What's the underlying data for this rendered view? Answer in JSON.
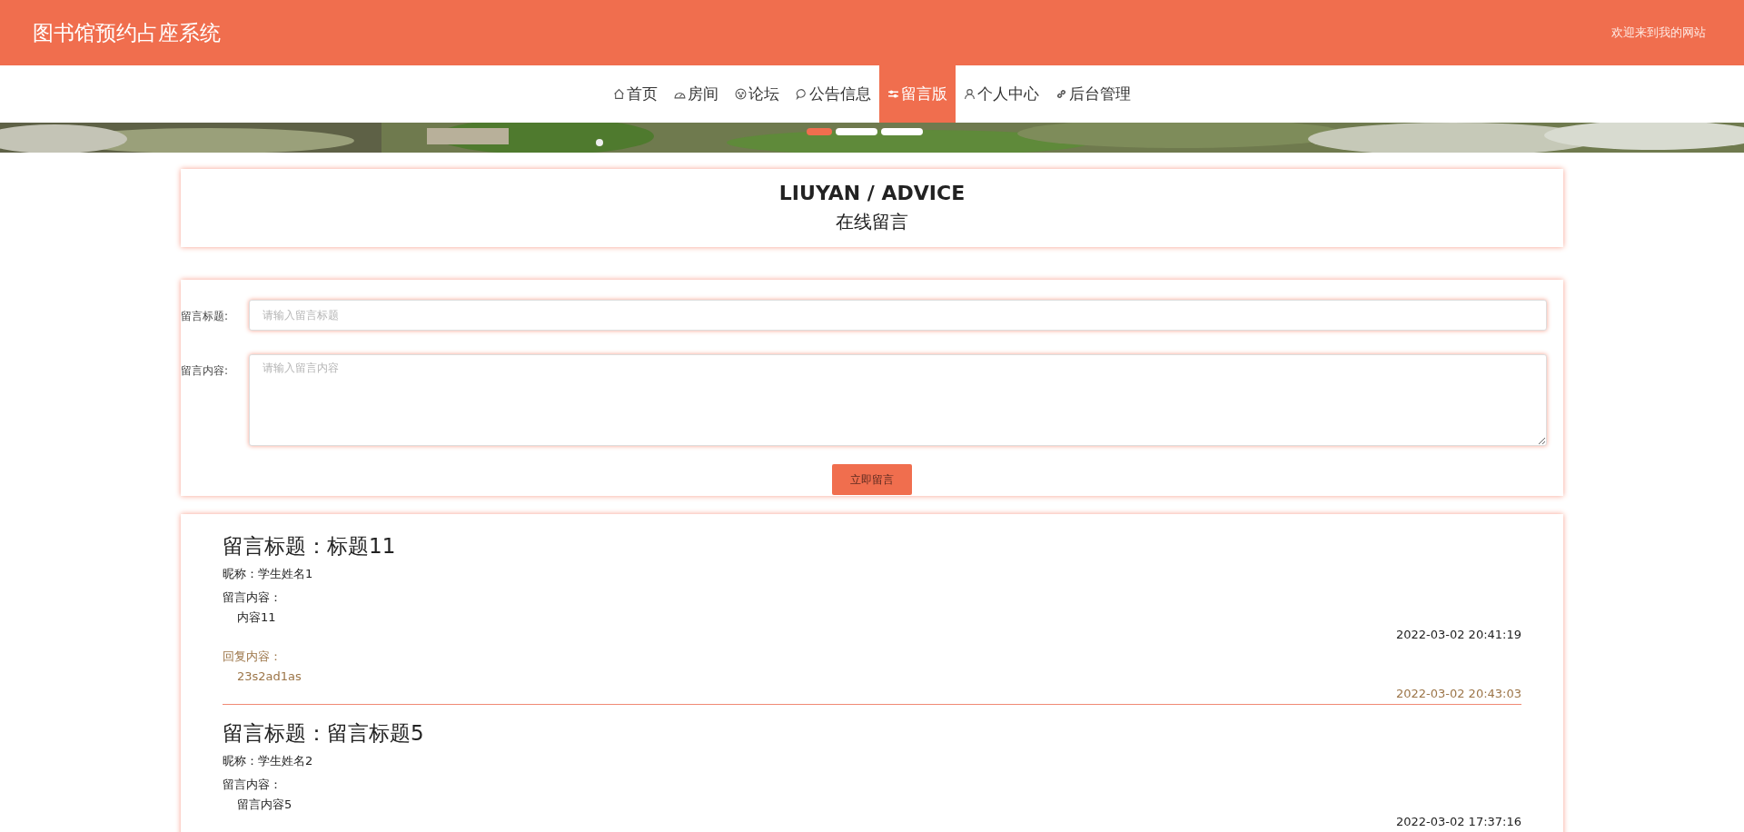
{
  "header": {
    "title": "图书馆预约占座系统",
    "welcome": "欢迎来到我的网站"
  },
  "nav": [
    {
      "label": "首页",
      "kind": "home",
      "selected": false
    },
    {
      "label": "房间",
      "kind": "gauge",
      "selected": false
    },
    {
      "label": "论坛",
      "kind": "face",
      "selected": false
    },
    {
      "label": "公告信息",
      "kind": "bubble",
      "selected": false
    },
    {
      "label": "留言版",
      "kind": "sliders",
      "selected": true
    },
    {
      "label": "个人中心",
      "kind": "user",
      "selected": false
    },
    {
      "label": "后台管理",
      "kind": "link",
      "selected": false
    }
  ],
  "banner": {
    "kind": "picture",
    "indicators": [
      {
        "selected": true
      },
      {
        "selected": false
      },
      {
        "selected": false
      }
    ]
  },
  "heading": {
    "title": "LIUYAN / ADVICE",
    "subtitle": "在线留言"
  },
  "form": {
    "title_label": "留言标题:",
    "title_placeholder": "请输入留言标题",
    "content_label": "留言内容:",
    "content_placeholder": "请输入留言内容",
    "submit": "立即留言"
  },
  "messages": [
    {
      "title": "留言标题：标题11",
      "nickname": "昵称：学生姓名1",
      "content_label": "留言内容：",
      "content": "内容11",
      "time": "2022-03-02 20:41:19",
      "reply_label": "回复内容：",
      "reply": "23s2ad1as",
      "reply_time": "2022-03-02 20:43:03"
    },
    {
      "title": "留言标题：留言标题5",
      "nickname": "昵称：学生姓名2",
      "content_label": "留言内容：",
      "content": "留言内容5",
      "time": "2022-03-02 17:37:16"
    }
  ]
}
